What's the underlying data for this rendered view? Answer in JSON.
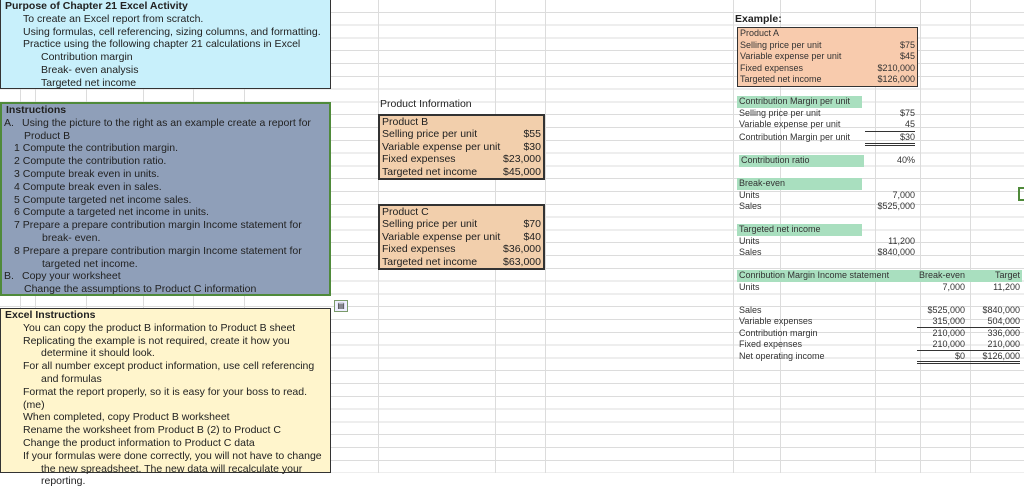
{
  "purpose": {
    "title": "Purpose of Chapter 21 Excel Activity",
    "lines": [
      "To create an Excel report from scratch.",
      "Using formulas, cell referencing, sizing columns, and formatting.",
      "Practice using the following chapter 21 calculations in Excel"
    ],
    "sub": [
      "Contribution margin",
      "Break- even analysis",
      "Targeted net income"
    ]
  },
  "instructions": {
    "title": "Instructions",
    "a_marker": "A.",
    "a_text": "Using  the picture to the right as an example create a report for",
    "a_cont": "Product B",
    "steps": [
      "1 Compute the contribution margin.",
      "2 Compute the contribution ratio.",
      "3 Compute break even in units.",
      "4 Compute break even in sales.",
      "5 Compute targeted net income sales.",
      "6 Compute a targeted net income in units.",
      "7 Prepare a prepare contribution margin Income statement for"
    ],
    "step7_cont": "break- even.",
    "step8": "8 Prepare a prepare contribution margin Income statement for",
    "step8_cont": "targeted net income.",
    "b_marker": "B.",
    "b_text": "Copy your worksheet",
    "b_cont": "Change the assumptions to Product C information"
  },
  "excel": {
    "title": "Excel Instructions",
    "l1": "You can copy the product B information to Product B sheet",
    "l2": "Replicating the example is not required, create it how you",
    "l2c": "determine it should look.",
    "l3": "For all number except product information, use cell referencing",
    "l3c": "and formulas",
    "l4": "Format the report properly, so it is easy for your boss to read. (me)",
    "l5": "When completed, copy Product B worksheet",
    "l6": "Rename the worksheet from Product B (2) to Product C",
    "l7": "Change the product information to Product C data",
    "l8": "If your formulas were done correctly, you will not have to change",
    "l8c": "the new spreadsheet. The new data will recalculate your reporting."
  },
  "product_info": {
    "label": "Product Information",
    "b": {
      "name": "Product B",
      "rows": [
        {
          "label": "Selling price per unit",
          "value": "$55"
        },
        {
          "label": "Variable expense per unit",
          "value": "$30"
        },
        {
          "label": "Fixed expenses",
          "value": "$23,000"
        },
        {
          "label": "Targeted net income",
          "value": "$45,000"
        }
      ]
    },
    "c": {
      "name": "Product C",
      "rows": [
        {
          "label": "Selling price per unit",
          "value": "$70"
        },
        {
          "label": "Variable expense per unit",
          "value": "$40"
        },
        {
          "label": "Fixed expenses",
          "value": "$36,000"
        },
        {
          "label": "Targeted net income",
          "value": "$63,000"
        }
      ]
    }
  },
  "example": {
    "label": "Example:",
    "product": "Product A",
    "rows": [
      {
        "label": "Selling price per unit",
        "value": "$75"
      },
      {
        "label": "Variable expense per unit",
        "value": "$45"
      },
      {
        "label": "Fixed expenses",
        "value": "$210,000"
      },
      {
        "label": "Targeted net income",
        "value": "$126,000"
      }
    ],
    "cm": {
      "title": "Contribution Margin per unit",
      "rows": [
        {
          "label": "Selling price per unit",
          "value": "$75"
        },
        {
          "label": "Variable expense per unit",
          "value": "45"
        },
        {
          "label": "Contribution Margin per unit",
          "value": "$30"
        }
      ]
    },
    "ratio": {
      "label": "Contribution ratio",
      "value": "40%"
    },
    "breakeven": {
      "title": "Break-even",
      "units_label": "Units",
      "units": "7,000",
      "sales_label": "Sales",
      "sales": "$525,000"
    },
    "target": {
      "title": "Targeted net income",
      "units_label": "Units",
      "units": "11,200",
      "sales_label": "Sales",
      "sales": "$840,000"
    },
    "statement": {
      "title": "Conribution Margin Income statement",
      "col1": "Break-even",
      "col2": "Target",
      "units_label": "Units",
      "units": [
        "7,000",
        "11,200"
      ],
      "rows": [
        {
          "label": "Sales",
          "v1": "$525,000",
          "v2": "$840,000"
        },
        {
          "label": "Variable expenses",
          "v1": "315,000",
          "v2": "504,000"
        },
        {
          "label": "Contribution margin",
          "v1": "210,000",
          "v2": "336,000"
        },
        {
          "label": "Fixed expenses",
          "v1": "210,000",
          "v2": "210,000"
        },
        {
          "label": "Net operating income",
          "v1": "$0",
          "v2": "$126,000"
        }
      ]
    }
  }
}
